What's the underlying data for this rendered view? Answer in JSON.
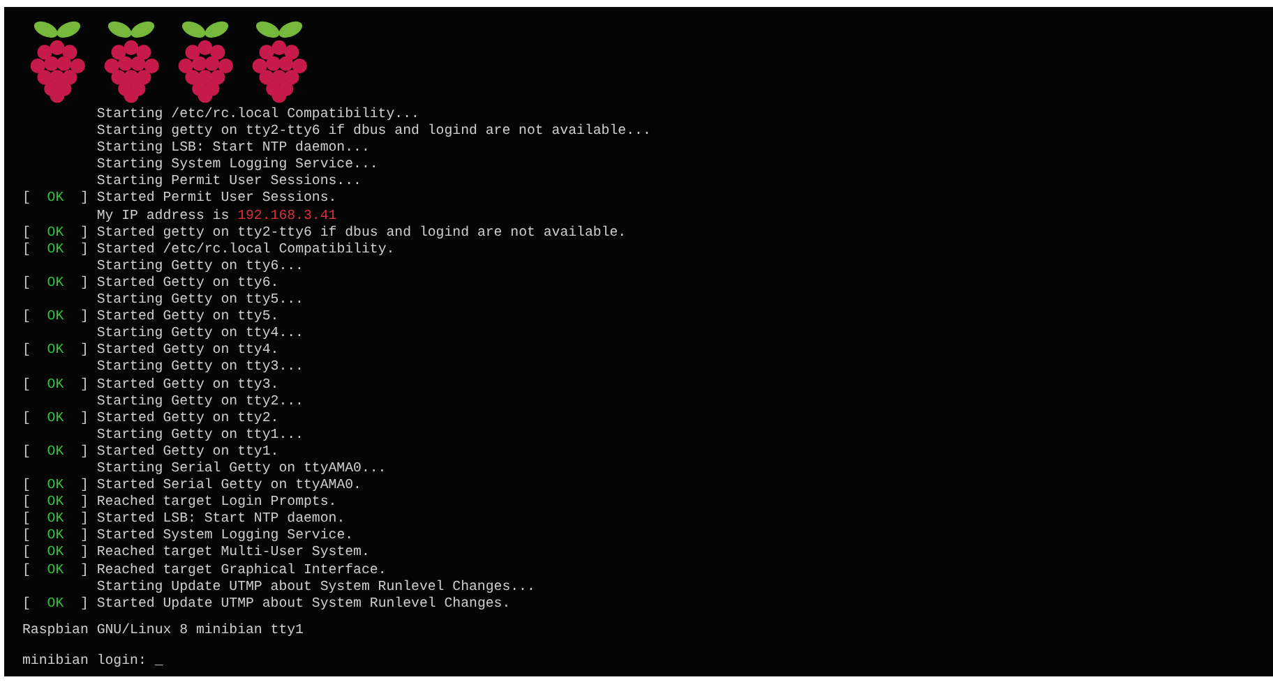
{
  "logos": [
    {
      "kind": "raspberry"
    },
    {
      "kind": "raspberry"
    },
    {
      "kind": "raspberry"
    },
    {
      "kind": "raspberry"
    }
  ],
  "lines": [
    {
      "kind": "plain",
      "text": "Starting /etc/rc.local Compatibility..."
    },
    {
      "kind": "plain",
      "text": "Starting getty on tty2-tty6 if dbus and logind are not available..."
    },
    {
      "kind": "plain",
      "text": "Starting LSB: Start NTP daemon..."
    },
    {
      "kind": "plain",
      "text": "Starting System Logging Service..."
    },
    {
      "kind": "plain",
      "text": "Starting Permit User Sessions..."
    },
    {
      "kind": "ok",
      "status": [
        "[",
        "OK",
        "]"
      ],
      "text": "Started Permit User Sessions."
    },
    {
      "kind": "address",
      "text": "My IP address is ",
      "address": "192.168.3.41"
    },
    {
      "kind": "ok",
      "status": [
        "[",
        "OK",
        "]"
      ],
      "text": "Started getty on tty2-tty6 if dbus and logind are not available."
    },
    {
      "kind": "ok",
      "status": [
        "[",
        "OK",
        "]"
      ],
      "text": "Started /etc/rc.local Compatibility."
    },
    {
      "kind": "plain",
      "text": "Starting Getty on tty6..."
    },
    {
      "kind": "ok",
      "status": [
        "[",
        "OK",
        "]"
      ],
      "text": "Started Getty on tty6."
    },
    {
      "kind": "plain",
      "text": "Starting Getty on tty5..."
    },
    {
      "kind": "ok",
      "status": [
        "[",
        "OK",
        "]"
      ],
      "text": "Started Getty on tty5."
    },
    {
      "kind": "plain",
      "text": "Starting Getty on tty4..."
    },
    {
      "kind": "ok",
      "status": [
        "[",
        "OK",
        "]"
      ],
      "text": "Started Getty on tty4."
    },
    {
      "kind": "plain",
      "text": "Starting Getty on tty3..."
    },
    {
      "kind": "ok",
      "status": [
        "[",
        "OK",
        "]"
      ],
      "text": "Started Getty on tty3."
    },
    {
      "kind": "plain",
      "text": "Starting Getty on tty2..."
    },
    {
      "kind": "ok",
      "status": [
        "[",
        "OK",
        "]"
      ],
      "text": "Started Getty on tty2."
    },
    {
      "kind": "plain",
      "text": "Starting Getty on tty1..."
    },
    {
      "kind": "ok",
      "status": [
        "[",
        "OK",
        "]"
      ],
      "text": "Started Getty on tty1."
    },
    {
      "kind": "plain",
      "text": "Starting Serial Getty on ttyAMA0..."
    },
    {
      "kind": "ok",
      "status": [
        "[",
        "OK",
        "]"
      ],
      "text": "Started Serial Getty on ttyAMA0."
    },
    {
      "kind": "ok",
      "status": [
        "[",
        "OK",
        "]"
      ],
      "text": "Reached target Login Prompts."
    },
    {
      "kind": "ok",
      "status": [
        "[",
        "OK",
        "]"
      ],
      "text": "Started LSB: Start NTP daemon."
    },
    {
      "kind": "ok",
      "status": [
        "[",
        "OK",
        "]"
      ],
      "text": "Started System Logging Service."
    },
    {
      "kind": "ok",
      "status": [
        "[",
        "OK",
        "]"
      ],
      "text": "Reached target Multi-User System."
    },
    {
      "kind": "ok",
      "status": [
        "[",
        "OK",
        "]"
      ],
      "text": "Reached target Graphical Interface."
    },
    {
      "kind": "plain",
      "text": "Starting Update UTMP about System Runlevel Changes..."
    },
    {
      "kind": "ok",
      "status": [
        "[",
        "OK",
        "]"
      ],
      "text": "Started Update UTMP about System Runlevel Changes."
    }
  ],
  "banner": "Raspbian GNU/Linux 8 minibian tty1",
  "login": {
    "prompt": "minibian login: ",
    "cursor": "_"
  }
}
